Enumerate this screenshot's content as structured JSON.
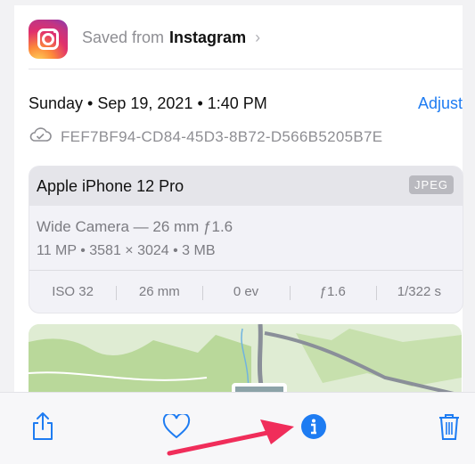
{
  "source": {
    "prefix": "Saved from",
    "app_name": "Instagram",
    "icon": "instagram-icon"
  },
  "date_time": "Sunday • Sep 19, 2021 • 1:40 PM",
  "adjust_label": "Adjust",
  "file_id": "FEF7BF94-CD84-45D3-8B72-D566B5205B7E",
  "device": {
    "name": "Apple iPhone 12 Pro",
    "format_badge": "JPEG",
    "camera": "Wide Camera — 26 mm ƒ1.6",
    "specs": "11 MP • 3581 × 3024 • 3 MB"
  },
  "exif": [
    "ISO 32",
    "26 mm",
    "0 ev",
    "ƒ1.6",
    "1/322 s"
  ],
  "toolbar": {
    "share": "share-icon",
    "favorite": "heart-icon",
    "info": "info-icon",
    "delete": "trash-icon"
  },
  "colors": {
    "accent": "#1e7cf2",
    "arrow": "#f02d5a"
  }
}
